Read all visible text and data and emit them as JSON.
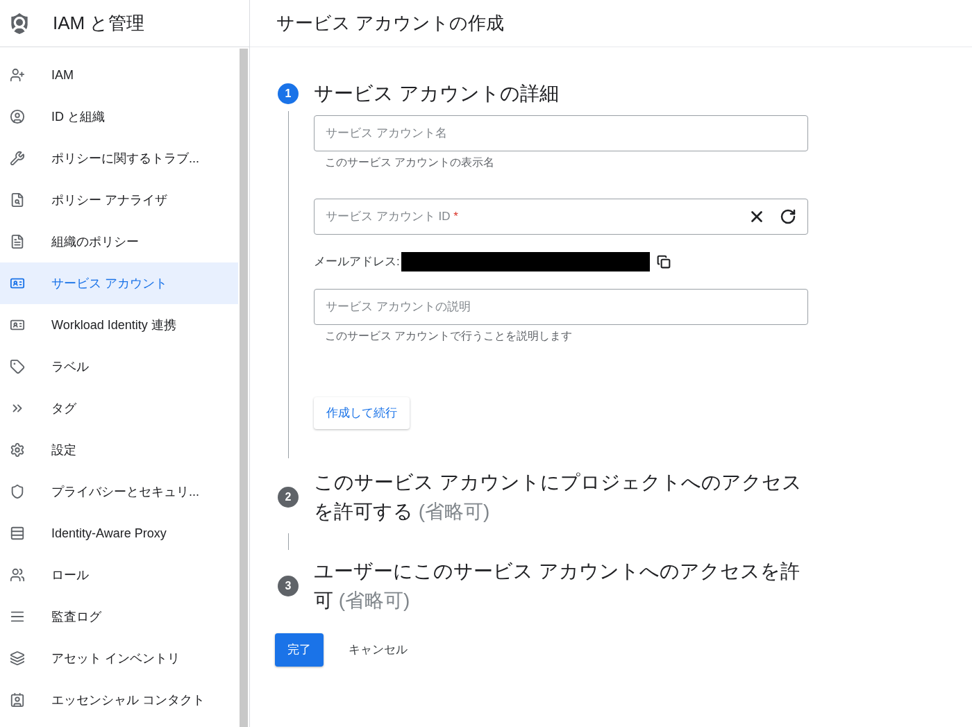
{
  "product": {
    "title": "IAM と管理"
  },
  "page": {
    "title": "サービス アカウントの作成"
  },
  "sidebar": {
    "items": [
      {
        "label": "IAM",
        "selected": false
      },
      {
        "label": "ID と組織",
        "selected": false
      },
      {
        "label": "ポリシーに関するトラブ...",
        "selected": false
      },
      {
        "label": "ポリシー アナライザ",
        "selected": false
      },
      {
        "label": "組織のポリシー",
        "selected": false
      },
      {
        "label": "サービス アカウント",
        "selected": true
      },
      {
        "label": "Workload Identity 連携",
        "selected": false
      },
      {
        "label": "ラベル",
        "selected": false
      },
      {
        "label": "タグ",
        "selected": false
      },
      {
        "label": "設定",
        "selected": false
      },
      {
        "label": "プライバシーとセキュリ...",
        "selected": false
      },
      {
        "label": "Identity-Aware Proxy",
        "selected": false
      },
      {
        "label": "ロール",
        "selected": false
      },
      {
        "label": "監査ログ",
        "selected": false
      },
      {
        "label": "アセット インベントリ",
        "selected": false
      },
      {
        "label": "エッセンシャル コンタクト",
        "selected": false
      }
    ]
  },
  "steps": [
    {
      "number": "1",
      "title": "サービス アカウントの詳細",
      "selected": true
    },
    {
      "number": "2",
      "title": "このサービス アカウントにプロジェクトへのアクセスを許可する",
      "optional": "(省略可)",
      "selected": false
    },
    {
      "number": "3",
      "title": "ユーザーにこのサービス アカウントへのアクセスを許可",
      "optional": "(省略可)",
      "selected": false
    }
  ],
  "form": {
    "name_field": {
      "placeholder": "サービス アカウント名",
      "hint": "このサービス アカウントの表示名"
    },
    "id_field": {
      "placeholder": "サービス アカウント ID",
      "required_mark": "*"
    },
    "email": {
      "label": "メールアドレス:"
    },
    "description_field": {
      "placeholder": "サービス アカウントの説明",
      "hint": "このサービス アカウントで行うことを説明します"
    },
    "continue_button": "作成して続行"
  },
  "actions": {
    "done": "完了",
    "cancel": "キャンセル"
  }
}
